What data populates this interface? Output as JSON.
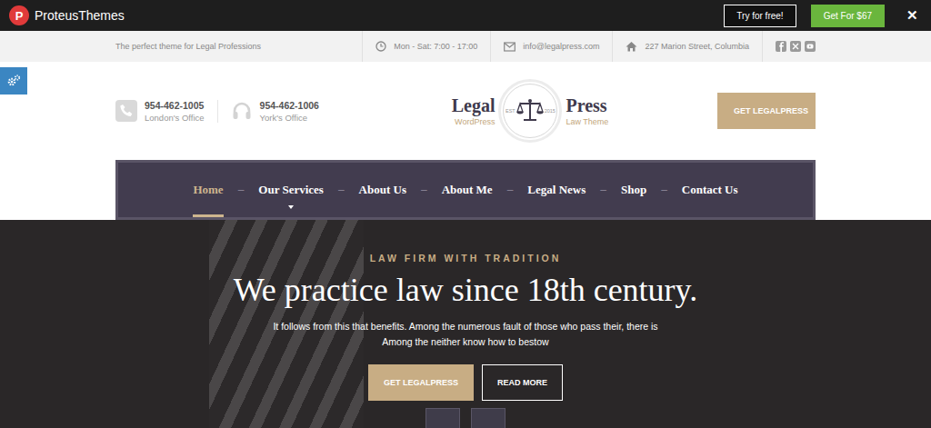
{
  "topbar": {
    "logo_letter": "P",
    "brand": "ProteusThemes",
    "buttons": [
      {
        "label": "Try for free!",
        "kind": "outline"
      },
      {
        "label": "Get For $67",
        "kind": "primary"
      }
    ],
    "close": "✕"
  },
  "info_bar": {
    "tagline": "The perfect theme for Legal Professions",
    "items": [
      {
        "kind": "clock",
        "text": "Mon - Sat: 7:00 - 17:00"
      },
      {
        "kind": "envelope",
        "text": "info@legalpress.com"
      },
      {
        "kind": "house",
        "text": "227 Marion Street, Columbia"
      }
    ],
    "socials": [
      "facebook",
      "x",
      "youtube"
    ]
  },
  "header": {
    "phones": [
      {
        "kind": "phone",
        "number": "954-462-1005",
        "label": "London's Office"
      },
      {
        "kind": "headset",
        "number": "954-462-1006",
        "label": "York's Office"
      }
    ],
    "logo": {
      "left": "Legal",
      "left_sub": "WordPress",
      "right": "Press",
      "right_sub": "Law Theme",
      "est": "EST",
      "year": "2015"
    },
    "cta": "GET LEGALPRESS"
  },
  "nav": {
    "separator": "–",
    "items": [
      {
        "label": "Home",
        "selected": true,
        "dropdown": false
      },
      {
        "label": "Our Services",
        "selected": false,
        "dropdown": true
      },
      {
        "label": "About Us",
        "selected": false,
        "dropdown": false
      },
      {
        "label": "About Me",
        "selected": false,
        "dropdown": false
      },
      {
        "label": "Legal News",
        "selected": false,
        "dropdown": false
      },
      {
        "label": "Shop",
        "selected": false,
        "dropdown": false
      },
      {
        "label": "Contact Us",
        "selected": false,
        "dropdown": false
      }
    ]
  },
  "hero": {
    "kicker": "LAW FIRM WITH TRADITION",
    "title": "We practice law since 18th century.",
    "lines": [
      "It follows from this that benefits. Among the numerous fault of those who pass their, there is",
      "Among the neither know how to bestow"
    ],
    "buttons": [
      {
        "label": "GET LEGALPRESS",
        "kind": "primary"
      },
      {
        "label": "READ MORE",
        "kind": "outline"
      }
    ]
  }
}
